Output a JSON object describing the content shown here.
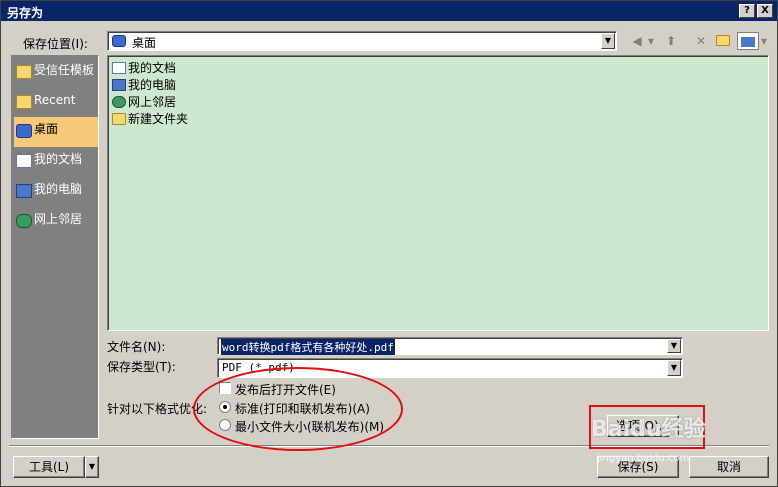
{
  "window": {
    "title": "另存为"
  },
  "titlebar": {
    "help_label": "?",
    "close_label": "X"
  },
  "location": {
    "label": "保存位置(I):",
    "value": "桌面"
  },
  "places": [
    {
      "label": "受信任模板",
      "icon": "folder-icon"
    },
    {
      "label": "Recent",
      "icon": "folder-icon"
    },
    {
      "label": "桌面",
      "icon": "desktop-icon",
      "selected": true
    },
    {
      "label": "我的文档",
      "icon": "documents-icon"
    },
    {
      "label": "我的电脑",
      "icon": "computer-icon"
    },
    {
      "label": "网上邻居",
      "icon": "network-icon"
    }
  ],
  "files": [
    {
      "label": "我的文档",
      "icon": "documents-icon"
    },
    {
      "label": "我的电脑",
      "icon": "computer-icon"
    },
    {
      "label": "网上邻居",
      "icon": "network-icon"
    },
    {
      "label": "新建文件夹",
      "icon": "folder-icon"
    }
  ],
  "filename": {
    "label": "文件名(N):",
    "value": "word转换pdf格式有各种好处.pdf"
  },
  "filetype": {
    "label": "保存类型(T):",
    "value": "PDF (*.pdf)"
  },
  "options": {
    "open_after_label": "发布后打开文件(E)",
    "optimize_label": "针对以下格式优化:",
    "standard_label": "标准(打印和联机发布)(A)",
    "minimum_label": "最小文件大小(联机发布)(M)",
    "options_button": "选项(O)..."
  },
  "footer": {
    "tools_label": "工具(L)",
    "save_label": "保存(S)",
    "cancel_label": "取消"
  },
  "watermark": {
    "brand": "Baidu经验",
    "url": "jingyan.baidu.com"
  },
  "colors": {
    "title_bar": "#0a246a",
    "file_list_bg": "#cce8cf",
    "highlight": "#e01010"
  }
}
